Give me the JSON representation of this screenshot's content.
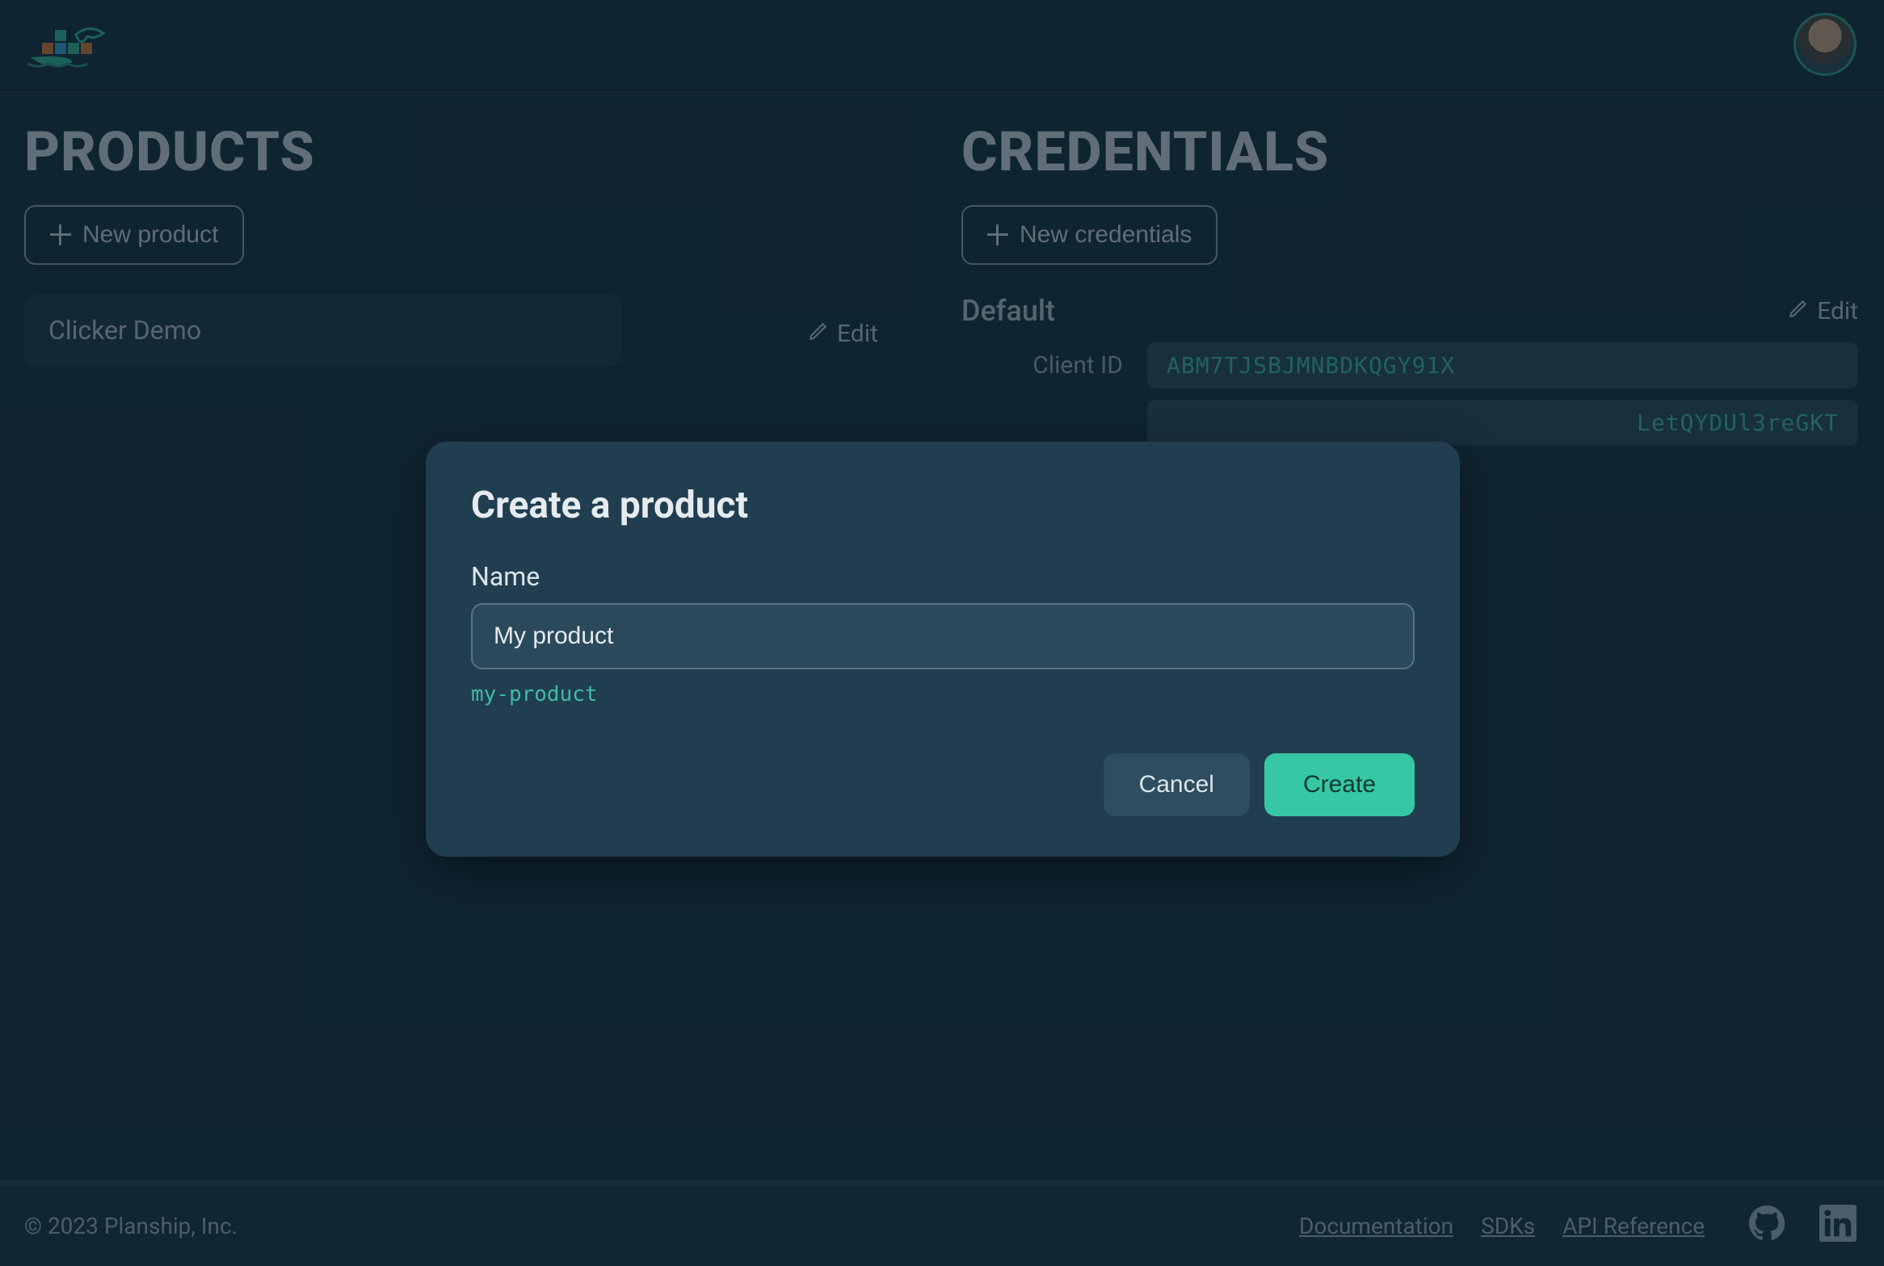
{
  "header": {
    "app_name": "Planship"
  },
  "products": {
    "title": "PRODUCTS",
    "new_button": "New product",
    "items": [
      {
        "name": "Clicker Demo",
        "edit": "Edit"
      }
    ]
  },
  "credentials": {
    "title": "CREDENTIALS",
    "new_button": "New credentials",
    "name": "Default",
    "edit": "Edit",
    "client_id_label": "Client ID",
    "client_id_value": "ABM7TJSBJMNBDKQGY91X",
    "secret_partial": "LetQYDUl3reGKT"
  },
  "modal": {
    "title": "Create a product",
    "name_label": "Name",
    "name_value": "My product",
    "slug": "my-product",
    "cancel": "Cancel",
    "create": "Create"
  },
  "footer": {
    "copyright": "© 2023 Planship, Inc.",
    "links": {
      "documentation": "Documentation",
      "sdks": "SDKs",
      "api_reference": "API Reference"
    }
  }
}
